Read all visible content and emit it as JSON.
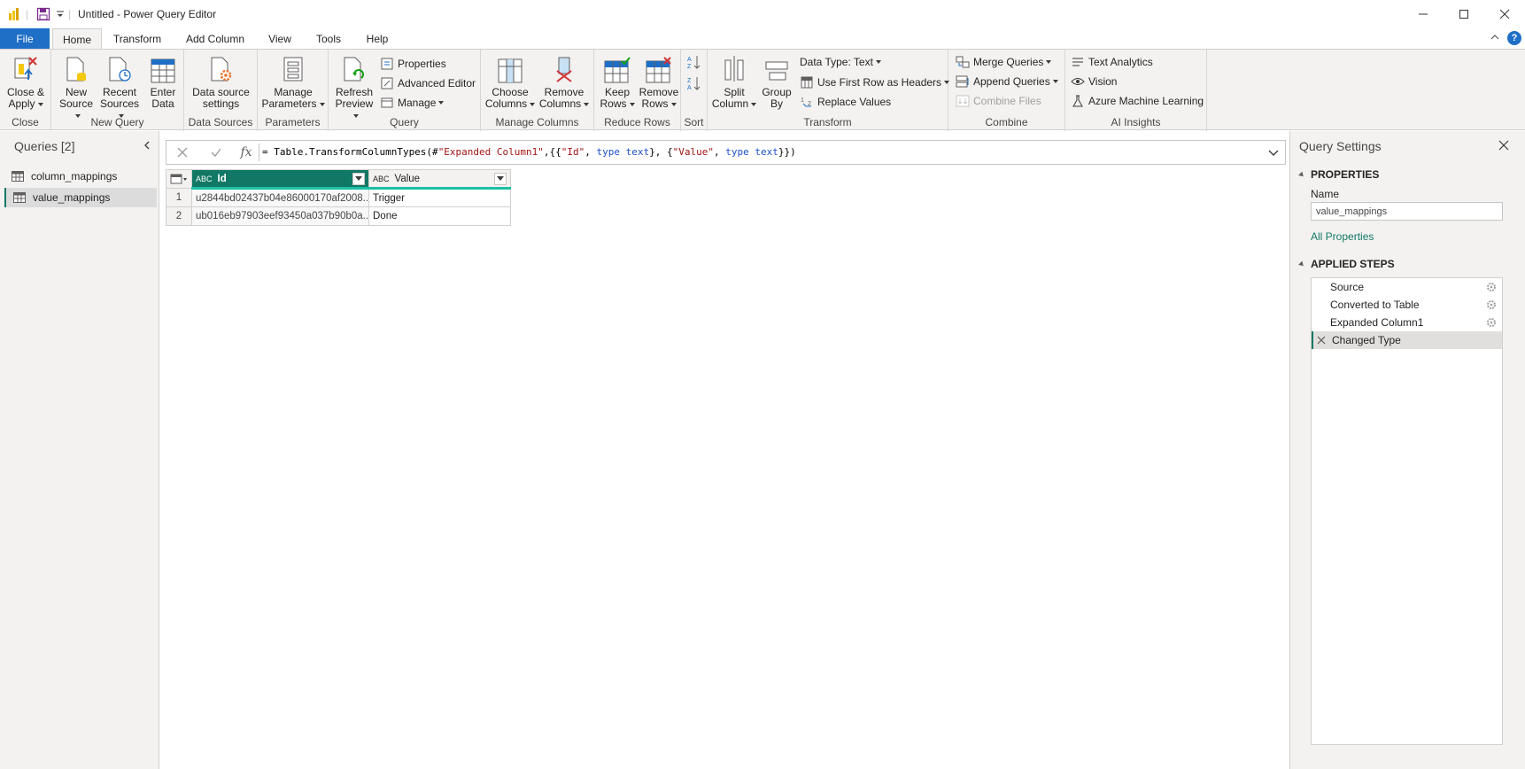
{
  "window": {
    "title": "Untitled - Power Query Editor"
  },
  "tabs": [
    {
      "label": "File"
    },
    {
      "label": "Home"
    },
    {
      "label": "Transform"
    },
    {
      "label": "Add Column"
    },
    {
      "label": "View"
    },
    {
      "label": "Tools"
    },
    {
      "label": "Help"
    }
  ],
  "ribbon": {
    "groups": {
      "close": "Close",
      "new_query": "New Query",
      "data_sources": "Data Sources",
      "parameters": "Parameters",
      "query": "Query",
      "manage_columns": "Manage Columns",
      "reduce_rows": "Reduce Rows",
      "sort": "Sort",
      "transform": "Transform",
      "combine": "Combine",
      "ai_insights": "AI Insights"
    },
    "buttons": {
      "close_apply_1": "Close &",
      "close_apply_2": "Apply",
      "new_source_1": "New",
      "new_source_2": "Source",
      "recent_sources_1": "Recent",
      "recent_sources_2": "Sources",
      "enter_data_1": "Enter",
      "enter_data_2": "Data",
      "ds_settings_1": "Data source",
      "ds_settings_2": "settings",
      "manage_params_1": "Manage",
      "manage_params_2": "Parameters",
      "refresh_1": "Refresh",
      "refresh_2": "Preview",
      "properties": "Properties",
      "advanced_editor": "Advanced Editor",
      "manage": "Manage",
      "choose_cols_1": "Choose",
      "choose_cols_2": "Columns",
      "remove_cols_1": "Remove",
      "remove_cols_2": "Columns",
      "keep_rows_1": "Keep",
      "keep_rows_2": "Rows",
      "remove_rows_1": "Remove",
      "remove_rows_2": "Rows",
      "split_col_1": "Split",
      "split_col_2": "Column",
      "group_by_1": "Group",
      "group_by_2": "By",
      "data_type": "Data Type: Text",
      "first_row_headers": "Use First Row as Headers",
      "replace_values": "Replace Values",
      "merge_queries": "Merge Queries",
      "append_queries": "Append Queries",
      "combine_files": "Combine Files",
      "text_analytics": "Text Analytics",
      "vision": "Vision",
      "azure_ml": "Azure Machine Learning"
    }
  },
  "queries": {
    "title": "Queries [2]",
    "items": [
      {
        "label": "column_mappings"
      },
      {
        "label": "value_mappings"
      }
    ]
  },
  "formula_bar": {
    "prefix": "= Table.TransformColumnTypes(#",
    "s1": "\"Expanded Column1\"",
    "p1": ",{{",
    "s2": "\"Id\"",
    "p2": ", ",
    "kw1": "type",
    "p3": " ",
    "kw2": "text",
    "p4": "}, {",
    "s3": "\"Value\"",
    "p5": ", ",
    "kw3": "type",
    "p6": " ",
    "kw4": "text",
    "p7": "}})"
  },
  "grid": {
    "columns": [
      {
        "label": "Id",
        "type": "ABC"
      },
      {
        "label": "Value",
        "type": "ABC"
      }
    ],
    "rows": [
      {
        "n": "1",
        "id": "u2844bd02437b04e86000170af2008...",
        "value": "Trigger"
      },
      {
        "n": "2",
        "id": "ub016eb97903eef93450a037b90b0a...",
        "value": "Done"
      }
    ]
  },
  "settings": {
    "title": "Query Settings",
    "properties_header": "PROPERTIES",
    "name_label": "Name",
    "name_value": "value_mappings",
    "all_properties": "All Properties",
    "steps_header": "APPLIED STEPS",
    "steps": [
      {
        "label": "Source"
      },
      {
        "label": "Converted to Table"
      },
      {
        "label": "Expanded Column1"
      },
      {
        "label": "Changed Type"
      }
    ]
  },
  "colors": {
    "accent": "#117865",
    "file_tab": "#1e6fc5",
    "help": "#1e6fc5"
  }
}
